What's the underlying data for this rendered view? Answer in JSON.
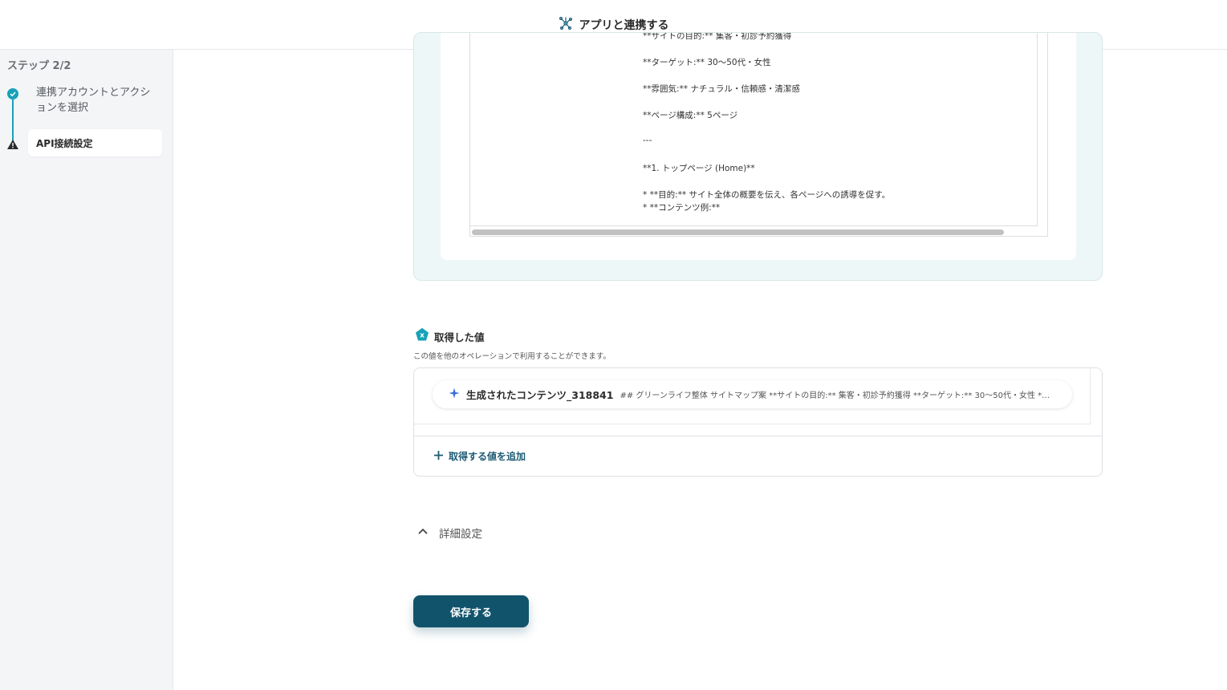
{
  "header": {
    "title": "アプリと連携する",
    "icon": "network-nodes-icon"
  },
  "sidebar": {
    "step_label": "ステップ 2/2",
    "steps": [
      {
        "label": "連携アカウントとアクションを選択",
        "status": "completed"
      },
      {
        "label": "API接続設定",
        "status": "warning"
      }
    ]
  },
  "preview": {
    "lines": [
      "**サイトの目的:** 集客・初診予約獲得",
      "**ターゲット:** 30〜50代・女性",
      "**雰囲気:** ナチュラル・信頼感・清潔感",
      "**ページ構成:** 5ページ",
      "---",
      "**1. トップページ (Home)**",
      "*   **目的:** サイト全体の概要を伝え、各ページへの誘導を促す。",
      "*   **コンテンツ例:**"
    ]
  },
  "outputs": {
    "title": "取得した値",
    "description": "この値を他のオペレーションで利用することができます。",
    "items": [
      {
        "name": "生成されたコンテンツ_318841",
        "value": "## グリーンライフ整体 サイトマップ案 **サイトの目的:** 集客・初診予約獲得 **ターゲット:** 30〜50代・女性 **雰囲気:** ナチュラル・信頼感・清潔感"
      }
    ],
    "add_label": "取得する値を追加"
  },
  "details": {
    "label": "詳細設定"
  },
  "save_button": {
    "label": "保存する"
  },
  "colors": {
    "accent": "#12536c",
    "teal": "#17a2b8",
    "panel_bg": "#eef7f7"
  }
}
